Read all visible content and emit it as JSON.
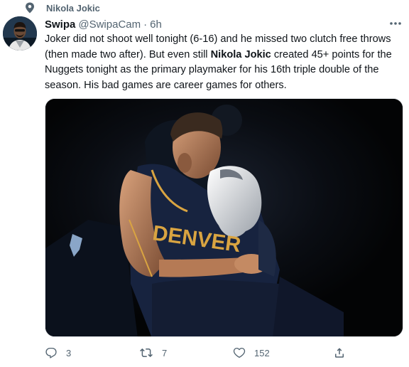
{
  "topic": {
    "label": "Nikola Jokic",
    "icon": "topic-icon"
  },
  "tweet": {
    "author_name": "Swipa",
    "author_handle": "@SwipaCam",
    "separator": "·",
    "timestamp": "6h",
    "more_icon": "more-horizontal-icon",
    "text_part1": "Joker did not shoot well tonight (6-16) and he missed two clutch free throws (then made two after). But even still ",
    "text_bold": "Nikola Jokic",
    "text_part2": " created 45+ points for the Nuggets tonight as the primary playmaker for his 16th triple double of the season. His bad games are career games for others."
  },
  "media": {
    "jersey_text": "DENVER"
  },
  "actions": {
    "replies": "3",
    "retweets": "7",
    "likes": "152",
    "icons": [
      "reply-icon",
      "retweet-icon",
      "like-icon",
      "share-icon"
    ]
  },
  "colors": {
    "text": "#0f1419",
    "secondary": "#536471",
    "jersey_gold": "#d9a441",
    "jersey_navy": "#17233f"
  }
}
